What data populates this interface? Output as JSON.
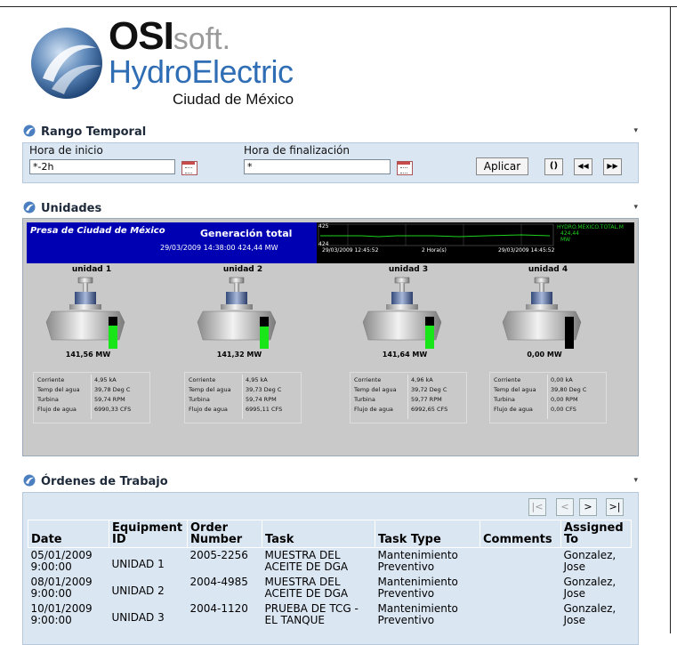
{
  "brand": {
    "line1_bold": "OSI",
    "line1_light": "soft.",
    "line2": "HydroElectric",
    "line3": "Ciudad de México"
  },
  "rango": {
    "title": "Rango Temporal",
    "start_label": "Hora de inicio",
    "start_value": "*-2h",
    "end_label": "Hora de finalización",
    "end_value": "*",
    "apply_label": "Aplicar",
    "refresh_glyph": "()",
    "back_glyph": "◀◀",
    "fwd_glyph": "▶▶"
  },
  "unidades": {
    "title": "Unidades",
    "plant_name": "Presa de Ciudad de México",
    "gen_title": "Generación total",
    "gen_value": "29/03/2009 14:38:00 424,44 MW",
    "trend": {
      "ymax": "425",
      "ymin": "424",
      "t_start": "29/03/2009 12:45:52",
      "span": "2 Hora(s)",
      "t_end": "29/03/2009 14:45:52",
      "tag": "HYDRO.MEXICO.TOTAL.M",
      "val": "424,44",
      "unit": "MW"
    },
    "units": [
      {
        "name": "unidad 1",
        "mw": "141,56 MW",
        "level": 0.72,
        "corriente": "4,95 kA",
        "temp": "39,78 Deg C",
        "turbina": "59,74 RPM",
        "flujo": "6990,33 CFS"
      },
      {
        "name": "unidad 2",
        "mw": "141,32 MW",
        "level": 0.7,
        "corriente": "4,95 kA",
        "temp": "39,73 Deg C",
        "turbina": "59,74 RPM",
        "flujo": "6995,11 CFS"
      },
      {
        "name": "unidad 3",
        "mw": "141,64 MW",
        "level": 0.72,
        "corriente": "4,96 kA",
        "temp": "39,72 Deg C",
        "turbina": "59,77 RPM",
        "flujo": "6992,65 CFS"
      },
      {
        "name": "unidad 4",
        "mw": "0,00 MW",
        "level": 0,
        "corriente": "0,00 kA",
        "temp": "39,80 Deg C",
        "turbina": "0,00 RPM",
        "flujo": "0,00 CFS"
      }
    ],
    "labels": {
      "corriente": "Corriente",
      "temp": "Temp del agua",
      "turbina": "Turbina",
      "flujo": "Flujo de agua"
    }
  },
  "ordenes": {
    "title": "Órdenes de Trabajo",
    "pager": [
      "|<",
      "<",
      ">",
      ">|"
    ],
    "headers": {
      "date": "Date",
      "equip": "Equipment ID",
      "order": "Order Number",
      "task": "Task",
      "type": "Task Type",
      "comments": "Comments",
      "assigned": "Assigned To"
    },
    "rows": [
      {
        "date": "05/01/2009 9:00:00",
        "equip": "UNIDAD 1",
        "order": "2005-2256",
        "task": "MUESTRA DEL ACEITE DE DGA",
        "type": "Mantenimiento Preventivo",
        "comments": "",
        "assigned": "Gonzalez, Jose"
      },
      {
        "date": "08/01/2009 9:00:00",
        "equip": "UNIDAD 2",
        "order": "2004-4985",
        "task": "MUESTRA DEL ACEITE DE DGA",
        "type": "Mantenimiento Preventivo",
        "comments": "",
        "assigned": "Gonzalez, Jose"
      },
      {
        "date": "10/01/2009 9:00:00",
        "equip": "UNIDAD 3",
        "order": "2004-1120",
        "task": "PRUEBA DE TCG - EL TANQUE",
        "type": "Mantenimiento Preventivo",
        "comments": "",
        "assigned": "Gonzalez, Jose"
      }
    ]
  }
}
